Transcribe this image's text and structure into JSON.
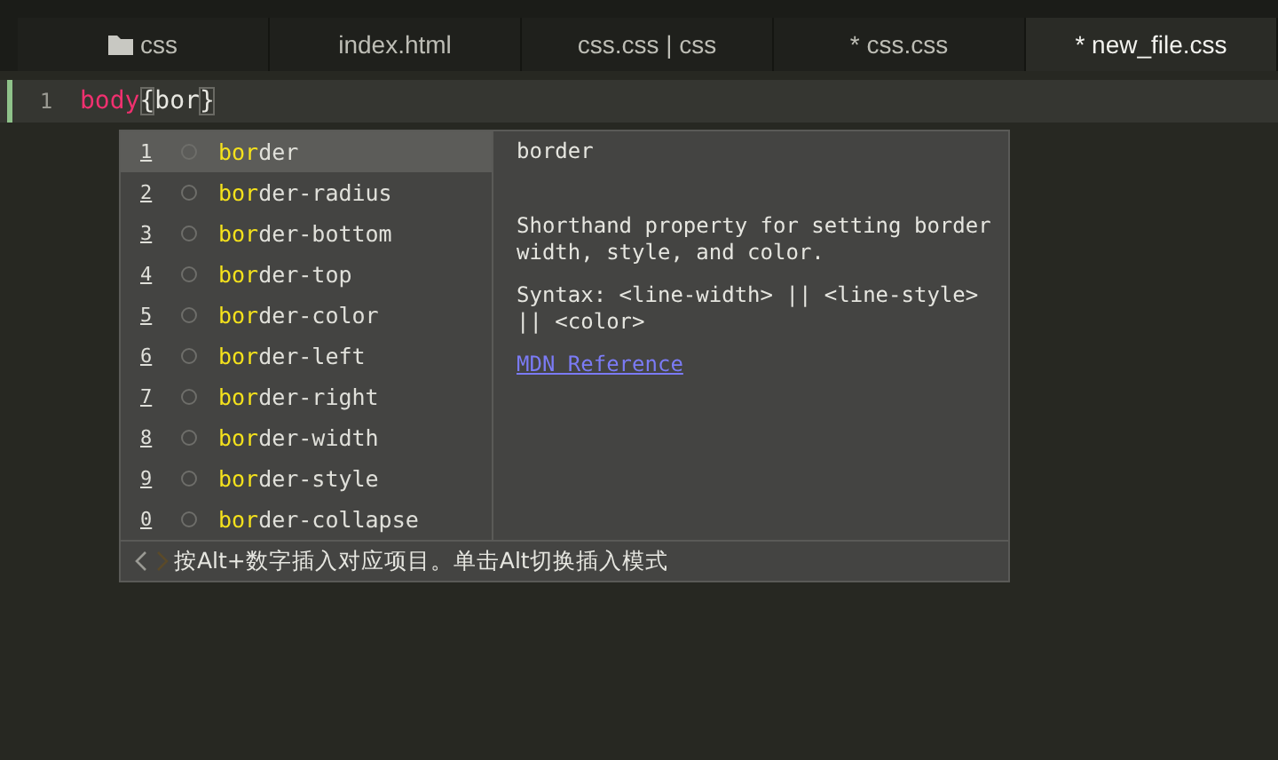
{
  "tabs": [
    {
      "label": "css",
      "kind": "folder",
      "selected": false
    },
    {
      "label": "index.html",
      "kind": "file",
      "selected": false
    },
    {
      "label": "css.css | css",
      "kind": "file",
      "selected": false
    },
    {
      "label": "* css.css",
      "kind": "file",
      "selected": false
    },
    {
      "label": "* new_file.css",
      "kind": "file",
      "selected": true
    }
  ],
  "editor": {
    "lines": [
      {
        "number": "1",
        "current": true,
        "tokens": [
          {
            "text": "body",
            "kind": "selector"
          },
          {
            "text": "{",
            "kind": "bracket"
          },
          {
            "text": "bor",
            "kind": "plain"
          },
          {
            "text": "}",
            "kind": "bracket"
          }
        ]
      }
    ]
  },
  "completion": {
    "items": [
      {
        "key": "1",
        "match": "bor",
        "rest": "der",
        "selected": true
      },
      {
        "key": "2",
        "match": "bor",
        "rest": "der-radius",
        "selected": false
      },
      {
        "key": "3",
        "match": "bor",
        "rest": "der-bottom",
        "selected": false
      },
      {
        "key": "4",
        "match": "bor",
        "rest": "der-top",
        "selected": false
      },
      {
        "key": "5",
        "match": "bor",
        "rest": "der-color",
        "selected": false
      },
      {
        "key": "6",
        "match": "bor",
        "rest": "der-left",
        "selected": false
      },
      {
        "key": "7",
        "match": "bor",
        "rest": "der-right",
        "selected": false
      },
      {
        "key": "8",
        "match": "bor",
        "rest": "der-width",
        "selected": false
      },
      {
        "key": "9",
        "match": "bor",
        "rest": "der-style",
        "selected": false
      },
      {
        "key": "0",
        "match": "bor",
        "rest": "der-collapse",
        "selected": false
      }
    ],
    "doc": {
      "title": "border",
      "description": "Shorthand property for setting border width, style, and color.",
      "syntax": "Syntax: <line-width> || <line-style> || <color>",
      "link": "MDN Reference"
    },
    "hint": "按Alt+数字插入对应项目。单击Alt切换插入模式"
  }
}
